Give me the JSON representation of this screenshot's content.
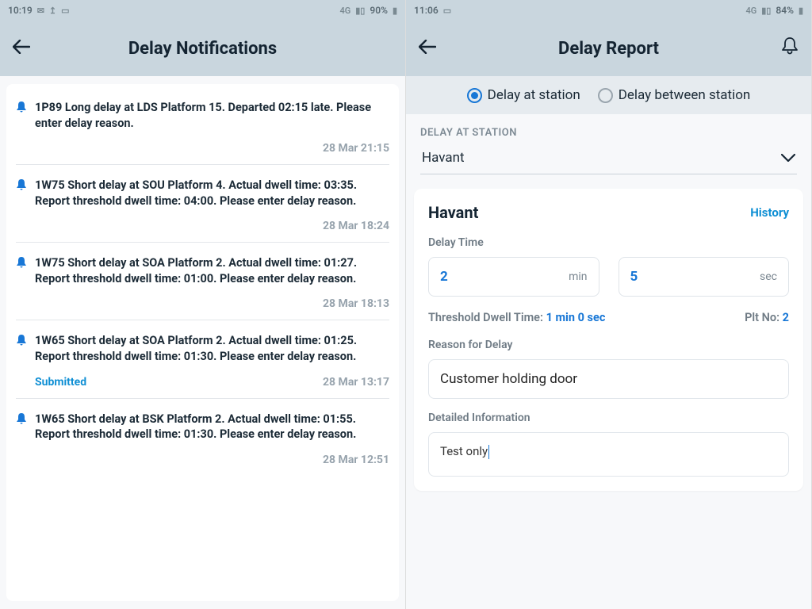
{
  "left": {
    "statusbar": {
      "time": "10:19",
      "battery": "90%"
    },
    "header": {
      "title": "Delay Notifications"
    },
    "notifications": [
      {
        "message": "1P89 Long delay at LDS Platform 15. Departed 02:15 late. Please enter delay reason.",
        "status": "",
        "timestamp": "28 Mar 21:15"
      },
      {
        "message": "1W75 Short delay at SOU Platform 4. Actual dwell time: 03:35. Report threshold dwell time: 04:00. Please enter delay reason.",
        "status": "",
        "timestamp": "28 Mar 18:24"
      },
      {
        "message": "1W75 Short delay at SOA Platform 2. Actual dwell time: 01:27. Report threshold dwell time: 01:00. Please enter delay reason.",
        "status": "",
        "timestamp": "28 Mar 18:13"
      },
      {
        "message": "1W65 Short delay at SOA Platform 2. Actual dwell time: 01:25. Report threshold dwell time: 01:30. Please enter delay reason.",
        "status": "Submitted",
        "timestamp": "28 Mar 13:17"
      },
      {
        "message": "1W65 Short delay at BSK Platform 2. Actual dwell time: 01:55. Report threshold dwell time: 01:30. Please enter delay reason.",
        "status": "",
        "timestamp": "28 Mar 12:51"
      }
    ]
  },
  "right": {
    "statusbar": {
      "time": "11:06",
      "battery": "84%"
    },
    "header": {
      "title": "Delay Report"
    },
    "radio": {
      "option1": "Delay at station",
      "option2": "Delay between station",
      "selected": 0
    },
    "sectionLabel": "DELAY AT STATION",
    "selectedStation": "Havant",
    "report": {
      "station": "Havant",
      "historyLabel": "History",
      "delayTimeLabel": "Delay Time",
      "minValue": "2",
      "minUnit": "min",
      "secValue": "5",
      "secUnit": "sec",
      "thresholdLabel": "Threshold Dwell Time:",
      "thresholdValue": "1 min 0 sec",
      "pltLabel": "Plt No:",
      "pltValue": "2",
      "reasonLabel": "Reason for Delay",
      "reasonValue": "Customer holding door",
      "detailLabel": "Detailed Information",
      "detailValue": "Test only"
    }
  }
}
